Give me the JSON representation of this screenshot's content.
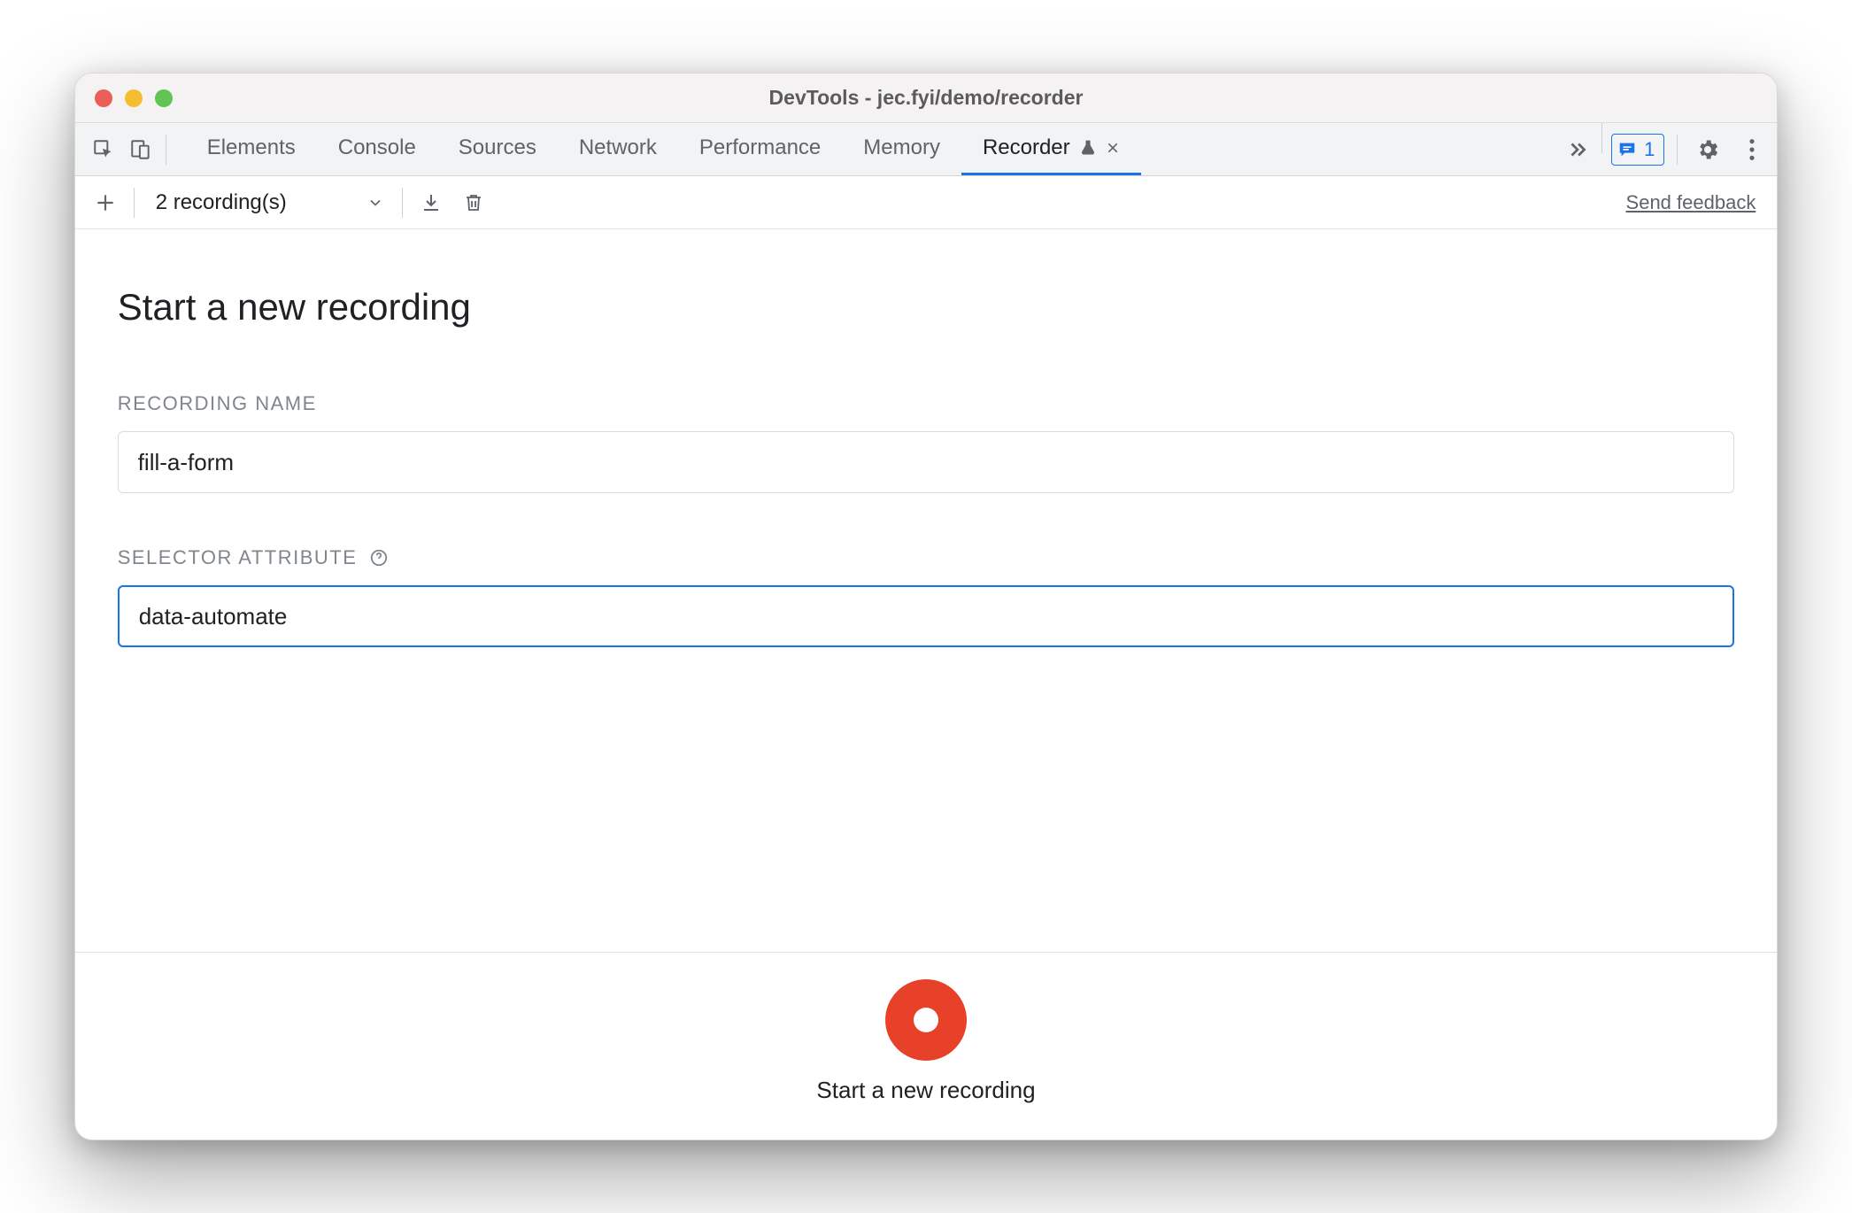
{
  "window": {
    "title": "DevTools - jec.fyi/demo/recorder"
  },
  "tabs": {
    "items": [
      "Elements",
      "Console",
      "Sources",
      "Network",
      "Performance",
      "Memory",
      "Recorder"
    ],
    "active": "Recorder",
    "activeHasBeaker": true
  },
  "issuesBadge": {
    "count": "1"
  },
  "toolbar": {
    "recordingsDropdown": "2 recording(s)",
    "feedbackLink": "Send feedback"
  },
  "main": {
    "title": "Start a new recording",
    "recordingName": {
      "label": "Recording Name",
      "value": "fill-a-form"
    },
    "selectorAttr": {
      "label": "Selector Attribute",
      "value": "data-automate"
    }
  },
  "footer": {
    "recordLabel": "Start a new recording"
  }
}
